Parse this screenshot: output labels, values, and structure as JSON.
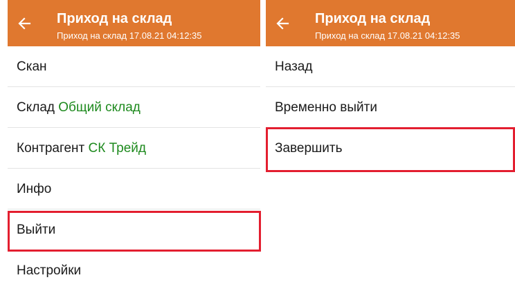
{
  "colors": {
    "header_bg": "#e0782f",
    "value_text": "#1e8a1e",
    "highlight": "#e31e2f"
  },
  "left_screen": {
    "header": {
      "title": "Приход на склад",
      "subtitle": "Приход на склад 17.08.21 04:12:35",
      "back_icon": "arrow-left-icon"
    },
    "menu": [
      {
        "label": "Скан"
      },
      {
        "label": "Склад",
        "value": "Общий склад"
      },
      {
        "label": "Контрагент",
        "value": "СК Трейд"
      },
      {
        "label": "Инфо"
      },
      {
        "label": "Выйти",
        "highlighted": true
      },
      {
        "label": "Настройки"
      }
    ]
  },
  "right_screen": {
    "header": {
      "title": "Приход на склад",
      "subtitle": "Приход на склад 17.08.21 04:12:35",
      "back_icon": "arrow-left-icon"
    },
    "menu": [
      {
        "label": "Назад"
      },
      {
        "label": "Временно выйти"
      },
      {
        "label": "Завершить",
        "highlighted": true
      }
    ]
  }
}
